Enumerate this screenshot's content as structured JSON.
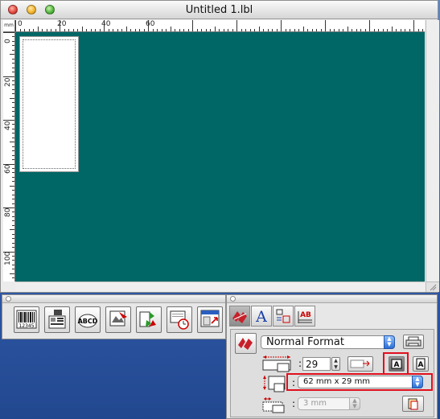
{
  "window": {
    "title": "Untitled 1.lbl"
  },
  "ruler": {
    "unit": "mm",
    "top_labels": [
      "0",
      "20",
      "40",
      "60"
    ],
    "left_labels": [
      "0",
      "20",
      "40",
      "60",
      "80",
      "100"
    ]
  },
  "colors": {
    "canvas": "#016666",
    "desktop": "#3f67b2",
    "highlight": "#e0101e",
    "popup_accent": "#2c6fd6"
  },
  "object_palette": {
    "tools": [
      {
        "name": "barcode-tool",
        "icon": "barcode-icon",
        "label": "12345"
      },
      {
        "name": "database-tool",
        "icon": "database-icon"
      },
      {
        "name": "arc-text-tool",
        "icon": "arc-text-icon",
        "label": "ABCD"
      },
      {
        "name": "image-tool",
        "icon": "image-icon"
      },
      {
        "name": "clip-art-tool",
        "icon": "clip-art-icon"
      },
      {
        "name": "date-time-tool",
        "icon": "date-time-icon"
      },
      {
        "name": "screen-capture-tool",
        "icon": "screen-capture-icon"
      }
    ]
  },
  "property_palette": {
    "tabs": [
      {
        "name": "layout-tab",
        "icon": "layout-icon",
        "active": true
      },
      {
        "name": "text-tab",
        "icon": "text-icon",
        "label": "A"
      },
      {
        "name": "frame-tab",
        "icon": "frame-icon"
      },
      {
        "name": "style-tab",
        "icon": "text-style-icon",
        "label": "AB"
      }
    ],
    "format_select": "Normal Format",
    "length_value": "29",
    "orientation_landscape_glyph": "A",
    "orientation_portrait_glyph": "A",
    "media_select": "62 mm x 29 mm",
    "margin_select": "3 mm",
    "separator": ":"
  }
}
